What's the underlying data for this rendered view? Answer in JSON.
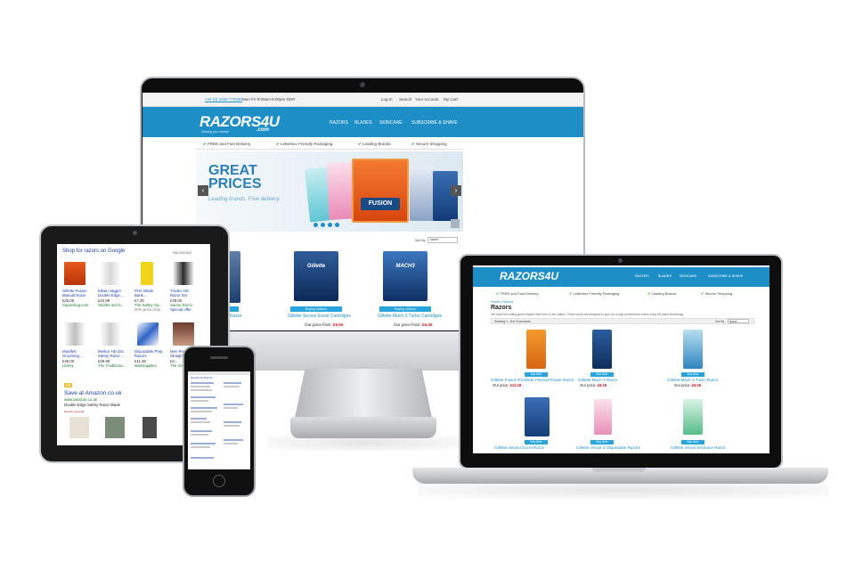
{
  "colors": {
    "brand_blue": "#1e8fc6",
    "price_red": "#d8111b",
    "check_green": "#2eaa3c",
    "button_blue": "#27a5dc"
  },
  "desktop": {
    "topbar": {
      "phone": "+44 (0) 1628 775330",
      "hours": "Mon-Fri 9:00am-5:00pm GMT",
      "links": [
        "Log In",
        "Search",
        "Your Account",
        "My Cart"
      ]
    },
    "logo": "RAZORS4U",
    "logo_suffix": ".com",
    "tagline": "Sharing you money!",
    "nav": [
      "RAZORS",
      "BLADES",
      "SKINCARE",
      "SUBSCRIBE & SHAVE"
    ],
    "usps": [
      "FREE and Fast Delivery",
      "Letterbox Friendly Packaging",
      "Leading Brands",
      "Secure Shopping"
    ],
    "banner": {
      "headline_1": "GREAT",
      "headline_2": "PRICES",
      "subline": "Leading brands. Free delivery.",
      "prev": "‹",
      "next": "›"
    },
    "sort": {
      "label": "Sort By",
      "value": "Name"
    },
    "products": [
      {
        "name": "Gillette Sensor Excel Cartridges",
        "price_label": "Our price from:",
        "price": "£6.65",
        "button": "Buying Options"
      },
      {
        "name": "Gillette Mach 3 Turbo Cartridges",
        "price_label": "Our price from:",
        "price": "£6.45",
        "button": "Buying Options"
      }
    ],
    "partial_product": {
      "name": "3 Razor",
      "price": "£"
    }
  },
  "tablet": {
    "heading": "Shop for razors on Google",
    "sponsored": "Sponsored",
    "row1": [
      {
        "l1": "Gillette Fusion",
        "l2": "Manual Razor",
        "price": "£25.00",
        "store": "Superdrug.com"
      },
      {
        "l1": "Edwin Jagger",
        "l2": "Double Edge ...",
        "price": "£22.99",
        "store": "Stubbs and S..."
      },
      {
        "l1": "PHC Blade",
        "l2": "Bank ...",
        "price": "£7.30",
        "store": "The Safety Sa..."
      },
      {
        "l1": "Trodeo 1M",
        "l2": "Razor Set",
        "price": "£30.00",
        "store": "Sanne Direct"
      }
    ],
    "row1_extra": [
      "",
      "",
      "20% price drop",
      "Special offer"
    ],
    "row2": [
      {
        "l1": "Merkur HD 34c",
        "l2": "Safety Razor ...",
        "price": "£29.95",
        "store": "The Traditiona..."
      },
      {
        "l1": "Disposable Prep",
        "l2": "Razors",
        "price": "£11.45",
        "store": "MedSupplies"
      },
      {
        "l1": "Men Rec...",
        "l2": "Straight...",
        "price": "£3...",
        "store": "The Gro..."
      }
    ],
    "row2_first": {
      "l1": "Mardlett",
      "l2": "Grooming ...",
      "price": "£45.00",
      "store": "Liberty"
    },
    "ad": {
      "badge": "Ad",
      "title": "Save at Amazon.co.uk",
      "url": "www.amazon.co.uk",
      "desc": "Double Edge Safety Razor Blade",
      "results": "Results received"
    }
  },
  "phone": {
    "header": "Results for Razors"
  },
  "laptop": {
    "logo": "RAZORS4U",
    "nav": [
      "RAZORS",
      "BLADES",
      "SKINCARE",
      "SUBSCRIBE & SHAVE"
    ],
    "usps": [
      "FREE and Fast Delivery",
      "Letterbox Friendly Packaging",
      "Leading Brands",
      "Secure Shopping"
    ],
    "breadcrumb": "Home / Razors",
    "title": "Razors",
    "intro": "Get more the cutting guide sharper than ever on the market. These razors are designed to give you a high performance shave using the latest technology.",
    "count": "Showing 1 - 8 of 20 products",
    "sort": {
      "label": "Sort by",
      "value": "Name"
    },
    "products": [
      {
        "name": "Gillette Fusion ProGlide Flexball Power Razor",
        "price": "£13.18",
        "button": "Buy Now"
      },
      {
        "name": "Gillette Mach 3 Razor",
        "price": "£6.18",
        "button": "Buy Now"
      },
      {
        "name": "Gillette Mach 3 Turbo Razor",
        "price": "£5.45",
        "button": "Buy Now"
      },
      {
        "name": "Gillette Sensor Excel Razor",
        "price": "",
        "button": "Buy Now"
      },
      {
        "name": "Gillette Venus 3 Disposable Razors",
        "price": "",
        "button": "Buy Now"
      },
      {
        "name": "Gillette Venus Embrace Razor",
        "price": "",
        "button": "Buy Now"
      }
    ],
    "price_label": "Our price:"
  }
}
